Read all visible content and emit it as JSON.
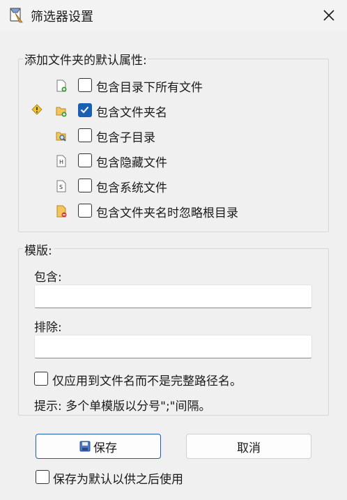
{
  "window": {
    "title": "筛选器设置"
  },
  "folder_defaults": {
    "legend": "添加文件夹的默认属性:",
    "options": [
      {
        "label": "包含目录下所有文件",
        "checked": false,
        "icon": "file-add-icon"
      },
      {
        "label": "包含文件夹名",
        "checked": true,
        "icon": "folder-add-icon",
        "warning": true
      },
      {
        "label": "包含子目录",
        "checked": false,
        "icon": "folder-search-icon"
      },
      {
        "label": "包含隐藏文件",
        "checked": false,
        "icon": "hidden-file-icon"
      },
      {
        "label": "包含系统文件",
        "checked": false,
        "icon": "system-file-icon"
      },
      {
        "label": "包含文件夹名时忽略根目录",
        "checked": false,
        "icon": "folder-root-icon"
      }
    ]
  },
  "template": {
    "legend": "模版:",
    "include_label": "包含:",
    "include_value": "",
    "exclude_label": "排除:",
    "exclude_value": "",
    "filename_only_label": "仅应用到文件名而不是完整路径名。",
    "filename_only_checked": false,
    "hint": "提示: 多个单模版以分号\";\"间隔。"
  },
  "buttons": {
    "save": "保存",
    "cancel": "取消"
  },
  "save_default": {
    "label": "保存为默认以供之后使用",
    "checked": false
  },
  "colors": {
    "accent": "#1a5fb4",
    "background": "#f0f0f0"
  }
}
